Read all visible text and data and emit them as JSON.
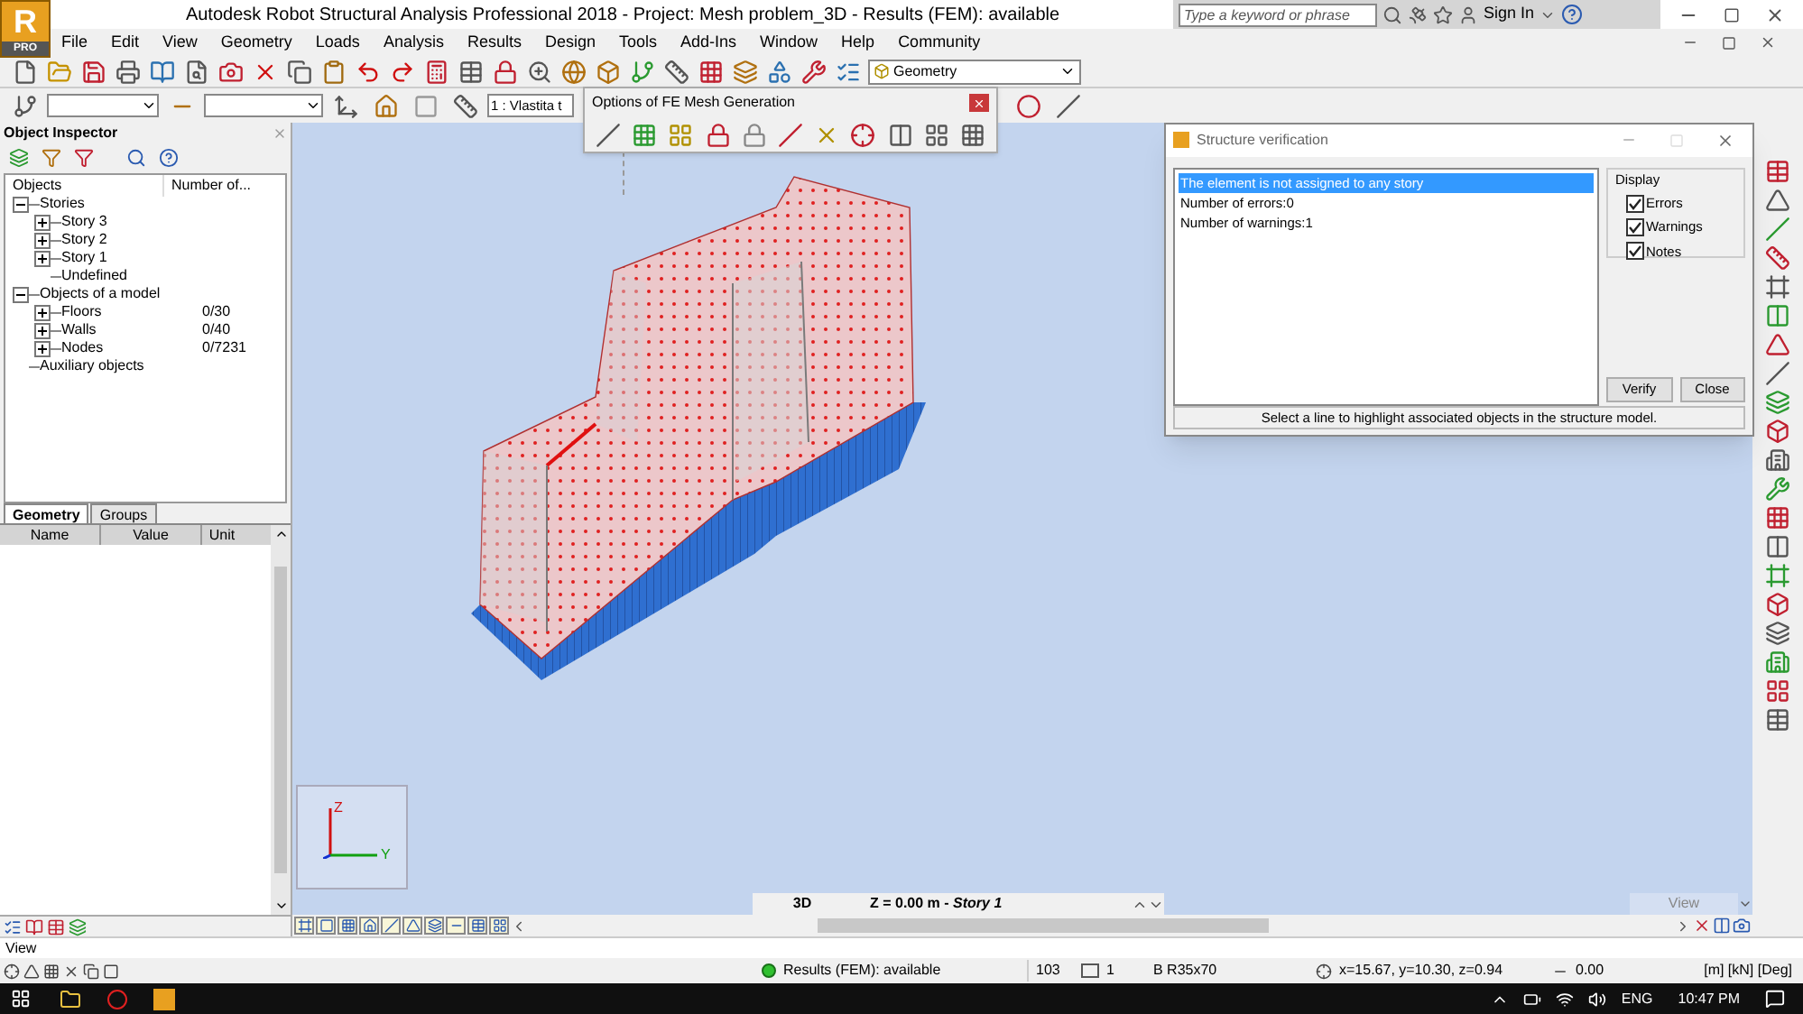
{
  "logo": {
    "letter": "R",
    "edition": "PRO"
  },
  "window": {
    "title": "Autodesk Robot Structural Analysis Professional 2018 - Project: Mesh problem_3D - Results (FEM): available"
  },
  "search": {
    "placeholder": "Type a keyword or phrase"
  },
  "sign_in": "Sign In",
  "menu": [
    "File",
    "Edit",
    "View",
    "Geometry",
    "Loads",
    "Analysis",
    "Results",
    "Design",
    "Tools",
    "Add-Ins",
    "Window",
    "Help",
    "Community"
  ],
  "layout_combo": "Geometry",
  "load_case_combo": "1 : Vlastita t",
  "object_inspector": {
    "title": "Object Inspector",
    "columns": [
      "Objects",
      "Number of..."
    ],
    "tree": [
      {
        "label": "Stories",
        "expanded": true,
        "children": [
          {
            "label": "Story 3",
            "expanded": false
          },
          {
            "label": "Story 2",
            "expanded": false
          },
          {
            "label": "Story 1",
            "expanded": false
          },
          {
            "label": "Undefined"
          }
        ]
      },
      {
        "label": "Objects of a model",
        "expanded": true,
        "children": [
          {
            "label": "Floors",
            "count": "0/30",
            "expanded": false
          },
          {
            "label": "Walls",
            "count": "0/40",
            "expanded": false
          },
          {
            "label": "Nodes",
            "count": "0/7231",
            "expanded": false
          }
        ]
      },
      {
        "label": "Auxiliary objects"
      }
    ],
    "tabs": [
      {
        "label": "Geometry",
        "selected": true
      },
      {
        "label": "Groups",
        "selected": false
      }
    ],
    "property_columns": [
      "Name",
      "Value",
      "Unit"
    ]
  },
  "mesh_toolbar": {
    "title": "Options of FE Mesh Generation"
  },
  "axes": {
    "z": "Z",
    "y": "Y"
  },
  "view_bar": {
    "mode": "3D",
    "level": "Z = 0.00 m - *Story 1*",
    "view_label": "View"
  },
  "verification": {
    "title": "Structure verification",
    "messages": [
      {
        "text": "The element is not assigned to any story",
        "selected": true
      },
      {
        "text": "Number of errors:0",
        "selected": false
      },
      {
        "text": "Number of warnings:1",
        "selected": false
      }
    ],
    "display_title": "Display",
    "display": [
      {
        "label": "Errors",
        "checked": true
      },
      {
        "label": "Warnings",
        "checked": true
      },
      {
        "label": "Notes",
        "checked": true
      }
    ],
    "buttons": [
      "Verify",
      "Close"
    ],
    "hint": "Select a line to highlight associated objects in the structure model."
  },
  "command_line": "View",
  "status": {
    "results": "Results (FEM): available",
    "nodes": "103",
    "case": "1",
    "section": "B R35x70",
    "coordinates": "x=15.67, y=10.30, z=0.94",
    "value": "0.00",
    "units": "[m] [kN] [Deg]"
  },
  "taskbar": {
    "language": "ENG",
    "time": "10:47 PM"
  }
}
